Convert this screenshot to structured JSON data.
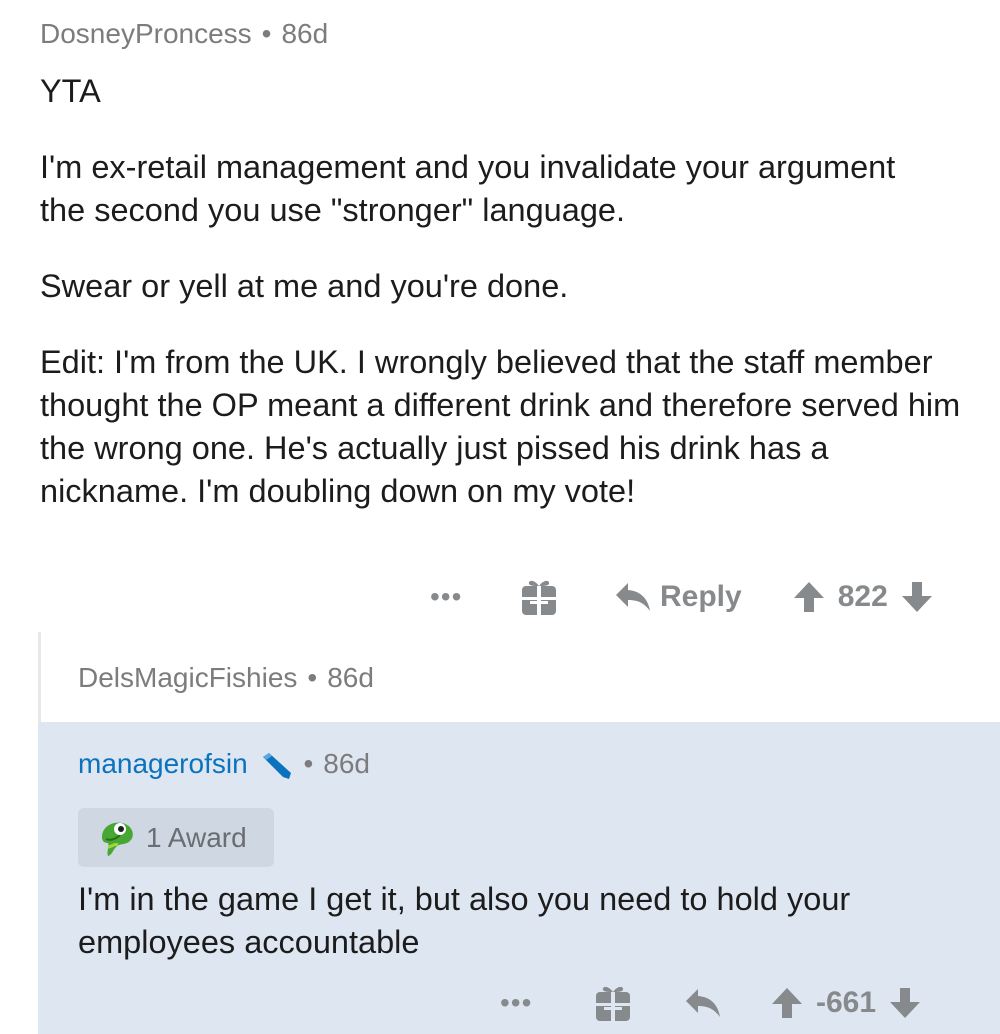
{
  "comment1": {
    "username": "DosneyProncess",
    "age": "86d",
    "paragraphs": [
      "YTA",
      "I'm ex-retail management and you invalidate your argument the second you use \"stronger\" language.",
      "Swear or yell at me and you're done.",
      "Edit: I'm from the UK. I wrongly believed that the staff member thought the OP meant a different drink and therefore served him the wrong one. He's actually just pissed his drink has a nickname. I'm doubling down on my vote!"
    ],
    "actions": {
      "more": "•••",
      "reply_label": "Reply",
      "score": "822"
    }
  },
  "comment2": {
    "username": "DelsMagicFishies",
    "age": "86d"
  },
  "comment3": {
    "username": "managerofsin",
    "age": "86d",
    "award_label": "1 Award",
    "text": "I'm in the game I get it, but also you need to hold your employees accountable",
    "actions": {
      "more": "•••",
      "score": "-661"
    }
  },
  "colors": {
    "highlight_bg": "#dde6f1",
    "username_link": "#0b73bd",
    "meta_gray": "#7c7c7c",
    "action_gray": "#878a8c"
  },
  "icons": [
    "gift-icon",
    "reply-arrow-icon",
    "upvote-arrow-icon",
    "downvote-arrow-icon",
    "mod-pencil-icon",
    "snoo-award-icon"
  ]
}
